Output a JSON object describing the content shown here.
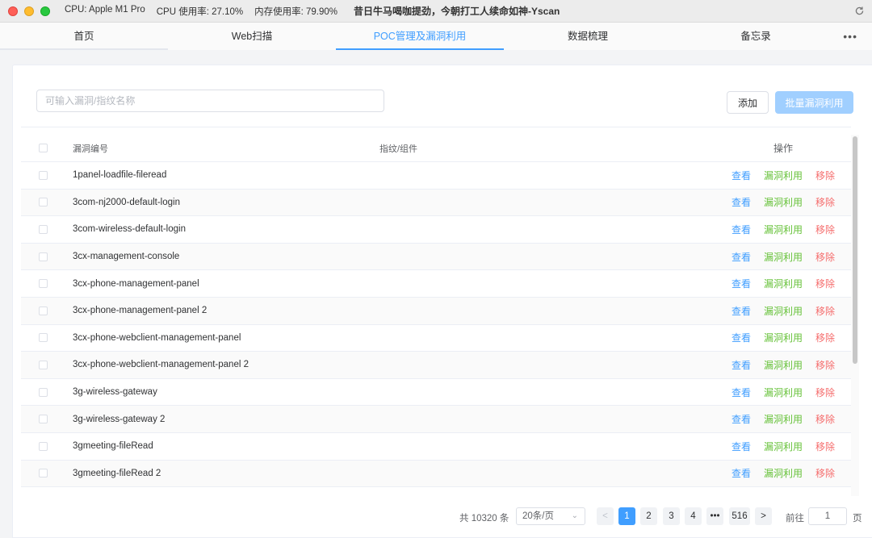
{
  "titlebar": {
    "cpu": "CPU: Apple M1 Pro",
    "cpu_usage": "CPU 使用率: 27.10%",
    "mem_usage": "内存使用率: 79.90%",
    "app_title": "昔日牛马喝咖提劲，今朝打工人续命如神-Yscan",
    "refresh_icon": "refresh-icon"
  },
  "tabs": [
    {
      "label": "首页"
    },
    {
      "label": "Web扫描"
    },
    {
      "label": "POC管理及漏洞利用"
    },
    {
      "label": "数据梳理"
    },
    {
      "label": "备忘录"
    }
  ],
  "tabs_more": "•••",
  "search": {
    "placeholder": "可输入漏洞/指纹名称"
  },
  "buttons": {
    "add": "添加",
    "batch": "批量漏洞利用"
  },
  "table": {
    "headers": {
      "id": "漏洞编号",
      "fingerprint": "指纹/组件",
      "ops": "操作"
    },
    "op_labels": {
      "view": "查看",
      "exploit": "漏洞利用",
      "remove": "移除"
    },
    "rows": [
      {
        "id": "1panel-loadfile-fileread"
      },
      {
        "id": "3com-nj2000-default-login"
      },
      {
        "id": "3com-wireless-default-login"
      },
      {
        "id": "3cx-management-console"
      },
      {
        "id": "3cx-phone-management-panel"
      },
      {
        "id": "3cx-phone-management-panel 2"
      },
      {
        "id": "3cx-phone-webclient-management-panel"
      },
      {
        "id": "3cx-phone-webclient-management-panel 2"
      },
      {
        "id": "3g-wireless-gateway"
      },
      {
        "id": "3g-wireless-gateway 2"
      },
      {
        "id": "3gmeeting-fileRead"
      },
      {
        "id": "3gmeeting-fileRead 2"
      }
    ]
  },
  "pagination": {
    "total": "共 10320 条",
    "page_size": "20条/页",
    "prev": "<",
    "pages": [
      "1",
      "2",
      "3",
      "4"
    ],
    "ellipsis": "•••",
    "last": "516",
    "next": ">",
    "goto_label": "前往",
    "goto_value": "1",
    "goto_unit": "页",
    "current": "1"
  },
  "colors": {
    "primary": "#409eff",
    "success": "#67c23a",
    "danger": "#f56c6c",
    "primary_disabled": "#a0cfff"
  }
}
